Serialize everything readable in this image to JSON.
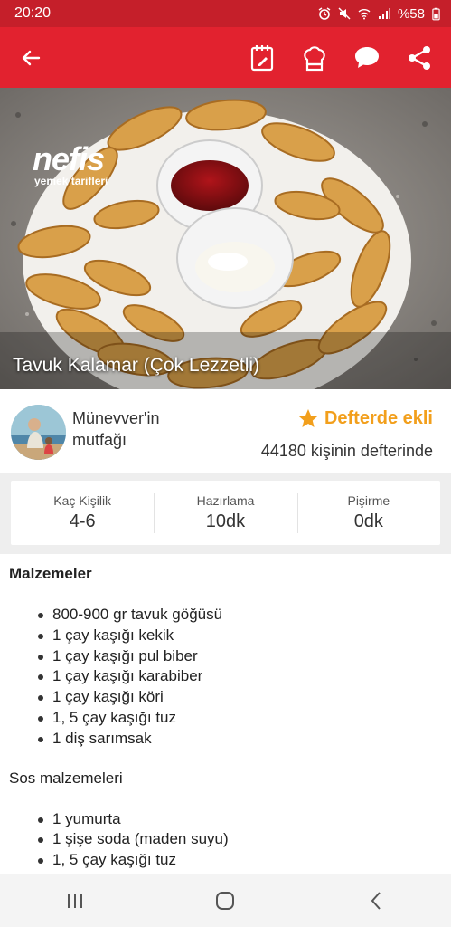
{
  "status_bar": {
    "time": "20:20",
    "battery": "%58",
    "icons": [
      "alarm-icon",
      "mute-icon",
      "wifi-icon",
      "signal-icon",
      "battery-icon"
    ]
  },
  "app_bar": {
    "icons": [
      "back-arrow-icon",
      "notebook-icon",
      "chef-hat-icon",
      "comment-icon",
      "share-icon"
    ],
    "background": "#e2222f"
  },
  "hero": {
    "title": "Tavuk Kalamar (Çok Lezzetli)",
    "logo_brand": "nefis",
    "logo_sub": "yemek tarifleri"
  },
  "author": {
    "name": "Münevver'in mutfağı",
    "favorite_label": "Defterde ekli",
    "favorite_count": "44180 kişinin defterinde",
    "accent": "#f29f1c"
  },
  "stats": [
    {
      "label": "Kaç Kişilik",
      "value": "4-6"
    },
    {
      "label": "Hazırlama",
      "value": "10dk"
    },
    {
      "label": "Pişirme",
      "value": "0dk"
    }
  ],
  "ingredients": {
    "heading": "Malzemeler",
    "main_items": [
      "800-900 gr tavuk göğüsü",
      "1 çay kaşığı kekik",
      "1 çay kaşığı pul biber",
      "1 çay kaşığı karabiber",
      "1 çay kaşığı köri",
      "1, 5 çay kaşığı tuz",
      "1 diş sarımsak"
    ],
    "sauce_heading": "Sos malzemeleri",
    "sauce_items": [
      "1 yumurta",
      "1 şişe soda (maden suyu)",
      "1, 5 çay kaşığı tuz"
    ]
  },
  "nav_bar": {
    "icons": [
      "recent-apps-icon",
      "home-icon",
      "back-icon"
    ]
  }
}
